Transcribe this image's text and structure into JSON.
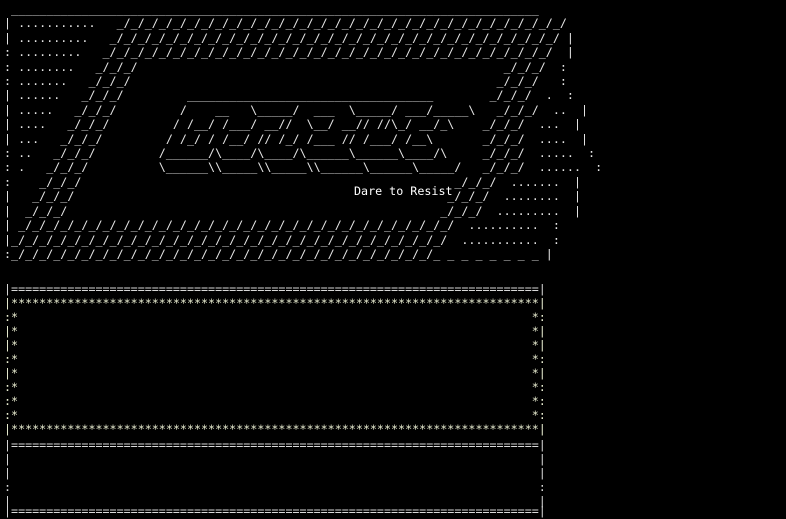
{
  "theme": {
    "background": "#000000",
    "text": "#e6e6e6",
    "star_color": "#e8ecd0"
  },
  "banner": {
    "art": " ___________________________________________________________________________\n| ...........   _/_/_/_/_/_/_/_/_/_/_/_/_/_/_/_/_/_/_/_/_/_/_/_/_/_/_/_/_/_/_/_/\n| ..........   _/_/_/_/_/_/_/_/_/_/_/_/_/_/_/_/_/_/_/_/_/_/_/_/_/_/_/_/_/_/_/_/ |\n: .........   _/_/_/_/_/_/_/_/_/_/_/_/_/_/_/_/_/_/_/_/_/_/_/_/_/_/_/_/_/_/_/_/  |\n: ........   _/_/_/                                                    _/_/_/  :\n: .......   _/_/_/                                                    _/_/_/   :\n| ......   _/_/_/         ___________________________________        _/_/_/  .  :\n| .....   _/_/_/         /    __   \\_____/  ___  \\_____/ ___/_____\\   _/_/_/  ..  |\n| ....   _/_/_/         / /__/ /___/ __//  \\__/ __// //\\_/ __/_\\    _/_/_/  ...  |\n| ...   _/_/_/         / /_/ / /__/ // /_/ /___ // /___/ /__\\       _/_/_/  ....  |\n: ..   _/_/_/         /______/\\____/\\____/\\______\\______\\____/\\     _/_/_/  .....  :\n: .   _/_/_/          \\______\\\\_____\\\\_____\\\\______\\______\\_____/   _/_/_/  ......  :\n:    _/_/_/                                                     _/_/_/  .......  |\n|   _/_/_/                                                     _/_/_/  ........  |\n|  _/_/_/                                                     _/_/_/  .........  |\n| _/_/_/_/_/_/_/_/_/_/_/_/_/_/_/_/_/_/_/_/_/_/_/_/_/_/_/_/_/_/_/  ..........  :\n|_/_/_/_/_/_/_/_/_/_/_/_/_/_/_/_/_/_/_/_/_/_/_/_/_/_/_/_/_/_/_/  ...........  :\n:_/_/_/_/_/_/_/_/_/_/_/_/_/_/_/_/_/_/_/_/_/_/_/_/_/_/_/_/_/_/_ _ _ _ _ _ _ _ |",
    "tagline": "Dare to Resist"
  },
  "divider_top": "|===========================================================================|",
  "star_panel": {
    "top_border": "|***************************************************************************|",
    "rows": [
      ":*                                                                         *:",
      "|*                                                                         *|",
      "|*                                                                         *|",
      ":*                                                                         *:",
      "|*                                                                         *|",
      ":*                                                                         *:",
      ":*                                                                         *:",
      ":*                                                                         *:"
    ],
    "bottom_border": "|***************************************************************************|"
  },
  "divider_middle": "|===========================================================================|",
  "blank_rows": [
    "|                                                                           |",
    "|                                                                           |",
    ":                                                                           :",
    "|                                                                           |"
  ],
  "divider_bottom": "|===========================================================================|"
}
